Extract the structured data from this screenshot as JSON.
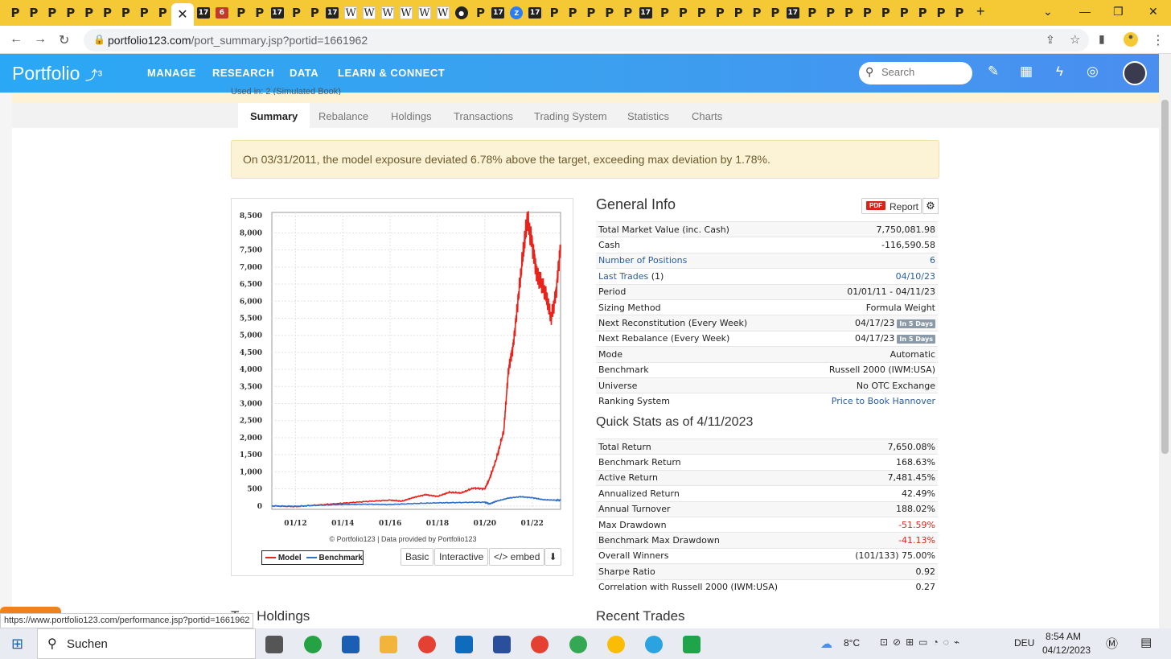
{
  "browser": {
    "url_host": "portfolio123.com",
    "url_path": "/port_summary.jsp?portid=1661962",
    "status_url": "https://www.portfolio123.com/performance.jsp?portid=1661962"
  },
  "site": {
    "logo": "Portfolio",
    "nav": [
      "MANAGE",
      "RESEARCH",
      "DATA",
      "LEARN & CONNECT"
    ],
    "search_placeholder": "Search"
  },
  "page": {
    "used_in": "Used in: 2 (Simulated Book)",
    "tabs": [
      "Summary",
      "Rebalance",
      "Holdings",
      "Transactions",
      "Trading System",
      "Statistics",
      "Charts"
    ],
    "alert": "On 03/31/2011, the model exposure deviated 6.78% above the target, exceeding max deviation by 1.78%."
  },
  "chart_data": {
    "type": "line",
    "x_tick_labels": [
      "01/12",
      "01/14",
      "01/16",
      "01/18",
      "01/20",
      "01/22"
    ],
    "y_tick_labels": [
      "8,500",
      "8,000",
      "7,500",
      "7,000",
      "6,500",
      "6,000",
      "5,500",
      "5,000",
      "4,500",
      "4,000",
      "3,500",
      "3,000",
      "2,500",
      "2,000",
      "1,500",
      "1,000",
      "500",
      "0"
    ],
    "ylim": [
      -100,
      8600
    ],
    "grid": true,
    "series": [
      {
        "name": "Model",
        "color": "#e8231c",
        "x": [
          2011.0,
          2012.0,
          2013.0,
          2014.0,
          2015.0,
          2016.0,
          2016.5,
          2017.0,
          2017.5,
          2018.0,
          2018.5,
          2019.0,
          2019.5,
          2020.0,
          2020.2,
          2020.5,
          2020.8,
          2021.0,
          2021.2,
          2021.4,
          2021.6,
          2021.8,
          2022.0,
          2022.2,
          2022.4,
          2022.6,
          2022.8,
          2023.0,
          2023.2
        ],
        "y": [
          0,
          -20,
          30,
          80,
          130,
          170,
          140,
          250,
          330,
          280,
          400,
          380,
          520,
          500,
          800,
          1400,
          2200,
          4000,
          4700,
          6000,
          7300,
          8400,
          7700,
          6800,
          6500,
          6100,
          5500,
          6200,
          7650
        ]
      },
      {
        "name": "Benchmark",
        "color": "#2f6fc9",
        "x": [
          2011.0,
          2012.0,
          2013.0,
          2014.0,
          2015.0,
          2016.0,
          2017.0,
          2018.0,
          2019.0,
          2020.0,
          2020.2,
          2020.5,
          2021.0,
          2021.5,
          2022.0,
          2022.5,
          2023.0,
          2023.2
        ],
        "y": [
          0,
          -10,
          20,
          40,
          50,
          40,
          70,
          90,
          100,
          110,
          60,
          140,
          230,
          270,
          240,
          180,
          170,
          169
        ]
      }
    ]
  },
  "chart_ui": {
    "credit": "© Portfolio123 | Data provided by Portfolio123",
    "legend_model": "Model",
    "legend_benchmark": "Benchmark",
    "btn_basic": "Basic",
    "btn_interactive": "Interactive",
    "btn_embed": "</> embed"
  },
  "general_info": {
    "title": "General Info",
    "report_badge": "PDF",
    "report_label": "Report",
    "rows": [
      {
        "label": "Total Market Value (inc. Cash)",
        "value": "7,750,081.98"
      },
      {
        "label": "Cash",
        "value": "-116,590.58"
      },
      {
        "label": "Number of Positions",
        "value": "6"
      },
      {
        "label": "Last Trades",
        "label_suffix": " (1)",
        "value": "04/10/23"
      },
      {
        "label": "Period",
        "value": "01/01/11 - 04/11/23"
      },
      {
        "label": "Sizing Method",
        "value": "Formula Weight"
      },
      {
        "label": "Next Reconstitution (Every Week)",
        "value": "04/17/23",
        "badge": "In 5 Days"
      },
      {
        "label": "Next Rebalance (Every Week)",
        "value": "04/17/23",
        "badge": "In 5 Days"
      },
      {
        "label": "Mode",
        "value": "Automatic"
      },
      {
        "label": "Benchmark",
        "value": "Russell 2000 (IWM:USA)"
      },
      {
        "label": "Universe",
        "value": "No OTC Exchange"
      },
      {
        "label": "Ranking System",
        "value": "Price to Book Hannover"
      }
    ]
  },
  "quick_stats": {
    "title": "Quick Stats as of 4/11/2023",
    "rows": [
      {
        "label": "Total Return",
        "value": "7,650.08%"
      },
      {
        "label": "Benchmark Return",
        "value": "168.63%"
      },
      {
        "label": "Active Return",
        "value": "7,481.45%"
      },
      {
        "label": "Annualized Return",
        "value": "42.49%"
      },
      {
        "label": "Annual Turnover",
        "value": "188.02%"
      },
      {
        "label": "Max Drawdown",
        "value": "-51.59%"
      },
      {
        "label": "Benchmark Max Drawdown",
        "value": "-41.13%"
      },
      {
        "label": "Overall Winners",
        "value": "(101/133) 75.00%"
      },
      {
        "label": "Sharpe Ratio",
        "value": "0.92"
      },
      {
        "label": "Correlation with Russell 2000 (IWM:USA)",
        "value": "0.27"
      }
    ]
  },
  "sections": {
    "top_holdings": "Top Holdings",
    "recent_trades": "Recent Trades"
  },
  "taskbar": {
    "search": "Suchen",
    "weather": "8°C",
    "lang": "DEU",
    "time": "8:54 AM",
    "date": "04/12/2023"
  }
}
